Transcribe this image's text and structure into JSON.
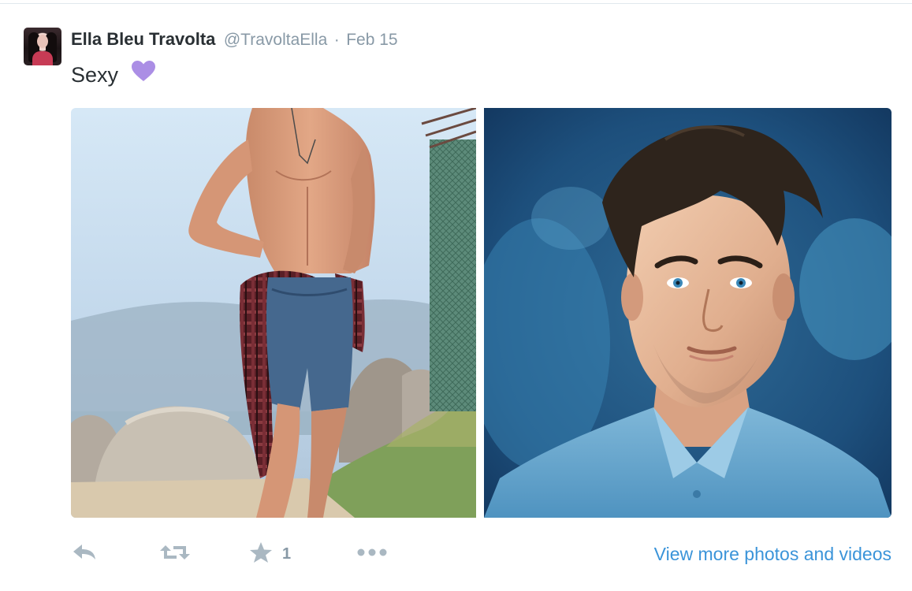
{
  "tweet": {
    "fullname": "Ella Bleu Travolta",
    "username": "@TravoltaElla",
    "separator": "·",
    "timestamp": "Feb 15",
    "text": "Sexy",
    "emoji_icon": "purple-heart-icon"
  },
  "media": {
    "photos": [
      {
        "name": "photo-left",
        "description_icon": "photo"
      },
      {
        "name": "photo-right",
        "description_icon": "photo"
      }
    ]
  },
  "actions": {
    "reply_icon": "reply-icon",
    "retweet_icon": "retweet-icon",
    "favorite_icon": "star-icon",
    "favorite_count": "1",
    "more_icon": "more-dots-icon",
    "view_more_label": "View more photos and videos"
  },
  "colors": {
    "name": "#292f33",
    "meta": "#8899a6",
    "link": "#3b94d9",
    "action_icon": "#aab8c2",
    "heart": "#ab8ee5"
  }
}
